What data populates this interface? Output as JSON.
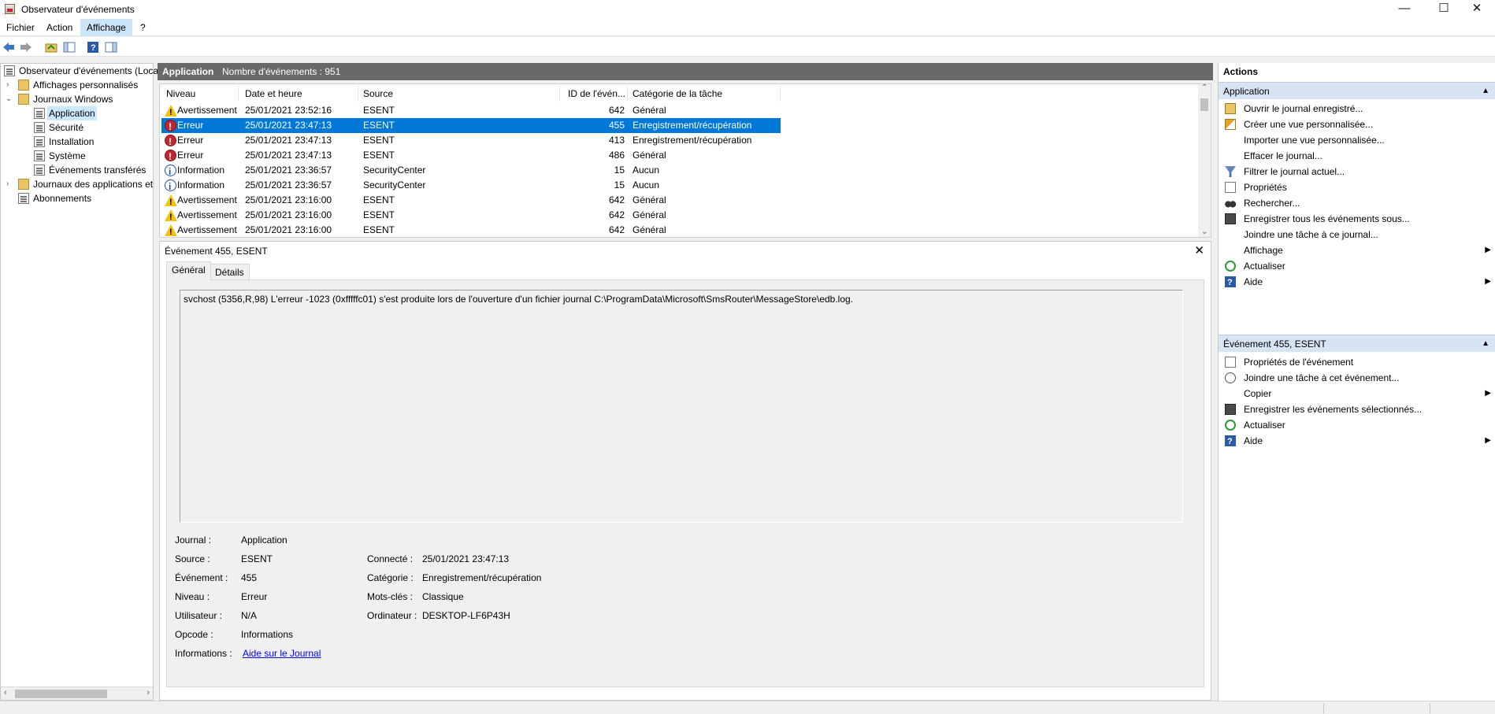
{
  "window": {
    "title": "Observateur d'événements",
    "minimize": "—",
    "maximize": "☐",
    "close": "✕"
  },
  "menu": [
    "Fichier",
    "Action",
    "Affichage",
    "?"
  ],
  "tree": {
    "root": "Observateur d'événements (Local)",
    "custom_views": "Affichages personnalisés",
    "windows_logs": "Journaux Windows",
    "application": "Application",
    "security": "Sécurité",
    "setup": "Installation",
    "system": "Système",
    "forwarded": "Événements transférés",
    "app_logs": "Journaux des applications et",
    "subscriptions": "Abonnements"
  },
  "center_header": {
    "title": "Application",
    "count": "Nombre d'événements : 951"
  },
  "columns": [
    "Niveau",
    "Date et heure",
    "Source",
    "ID de l'évén...",
    "Catégorie de la tâche"
  ],
  "events": [
    {
      "level": "Avertissement",
      "icon": "warning-icon",
      "date": "25/01/2021 23:52:16",
      "source": "ESENT",
      "id": "642",
      "category": "Général"
    },
    {
      "level": "Erreur",
      "icon": "error-icon",
      "date": "25/01/2021 23:47:13",
      "source": "ESENT",
      "id": "455",
      "category": "Enregistrement/récupération"
    },
    {
      "level": "Erreur",
      "icon": "error-icon",
      "date": "25/01/2021 23:47:13",
      "source": "ESENT",
      "id": "413",
      "category": "Enregistrement/récupération"
    },
    {
      "level": "Erreur",
      "icon": "error-icon",
      "date": "25/01/2021 23:47:13",
      "source": "ESENT",
      "id": "486",
      "category": "Général"
    },
    {
      "level": "Information",
      "icon": "info-icon",
      "date": "25/01/2021 23:36:57",
      "source": "SecurityCenter",
      "id": "15",
      "category": "Aucun"
    },
    {
      "level": "Information",
      "icon": "info-icon",
      "date": "25/01/2021 23:36:57",
      "source": "SecurityCenter",
      "id": "15",
      "category": "Aucun"
    },
    {
      "level": "Avertissement",
      "icon": "warning-icon",
      "date": "25/01/2021 23:16:00",
      "source": "ESENT",
      "id": "642",
      "category": "Général"
    },
    {
      "level": "Avertissement",
      "icon": "warning-icon",
      "date": "25/01/2021 23:16:00",
      "source": "ESENT",
      "id": "642",
      "category": "Général"
    },
    {
      "level": "Avertissement",
      "icon": "warning-icon",
      "date": "25/01/2021 23:16:00",
      "source": "ESENT",
      "id": "642",
      "category": "Général"
    }
  ],
  "detail": {
    "title": "Événement 455, ESENT",
    "close": "✕",
    "tabs": [
      "Général",
      "Détails"
    ],
    "message": "svchost (5356,R,98) L'erreur -1023 (0xfffffc01) s'est produite lors de l'ouverture d'un fichier journal C:\\ProgramData\\Microsoft\\SmsRouter\\MessageStore\\edb.log.",
    "labels": {
      "journal": "Journal :",
      "source": "Source :",
      "event": "Événement :",
      "level": "Niveau :",
      "user": "Utilisateur :",
      "opcode": "Opcode :",
      "info": "Informations :",
      "logged": "Connecté :",
      "category": "Catégorie :",
      "keywords": "Mots-clés :",
      "computer": "Ordinateur :"
    },
    "values": {
      "journal": "Application",
      "source": "ESENT",
      "event": "455",
      "level": "Erreur",
      "user": "N/A",
      "opcode": "Informations",
      "info_link": "Aide sur le Journal",
      "logged": "25/01/2021 23:47:13",
      "category": "Enregistrement/récupération",
      "keywords": "Classique",
      "computer": "DESKTOP-LF6P43H"
    }
  },
  "actions": {
    "title": "Actions",
    "section1": "Application",
    "items1": [
      "Ouvrir le journal enregistré...",
      "Créer une vue personnalisée...",
      "Importer une vue personnalisée...",
      "Effacer le journal...",
      "Filtrer le journal actuel...",
      "Propriétés",
      "Rechercher...",
      "Enregistrer tous les événements sous...",
      "Joindre une tâche à ce journal...",
      "Affichage",
      "Actualiser",
      "Aide"
    ],
    "section2": "Événement 455, ESENT",
    "items2": [
      "Propriétés de l'événement",
      "Joindre une tâche à cet événement...",
      "Copier",
      "Enregistrer les événements sélectionnés...",
      "Actualiser",
      "Aide"
    ]
  }
}
